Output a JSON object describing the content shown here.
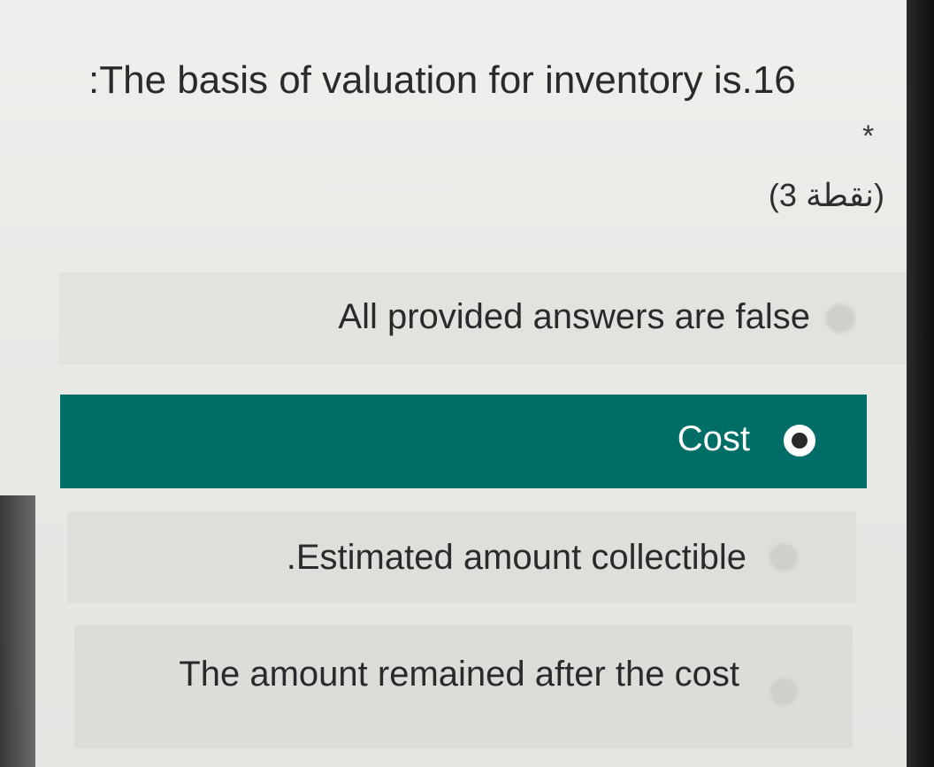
{
  "question": {
    "title": ":The basis of valuation for inventory is.16",
    "required_marker": "*",
    "points": "(3 نقطة)"
  },
  "options": [
    {
      "label": "All provided answers are false",
      "selected": false
    },
    {
      "label": "Cost",
      "selected": true
    },
    {
      "label": ".Estimated amount collectible",
      "selected": false
    },
    {
      "label": "The amount remained after the cost",
      "selected": false
    }
  ],
  "colors": {
    "selected_background": "#006d66",
    "selected_text": "#ffffff",
    "option_background": "#e2e2df",
    "text": "#2a2a2a"
  },
  "icons": {
    "radio_unselected": "radio-unselected-icon",
    "radio_selected": "radio-selected-icon"
  }
}
